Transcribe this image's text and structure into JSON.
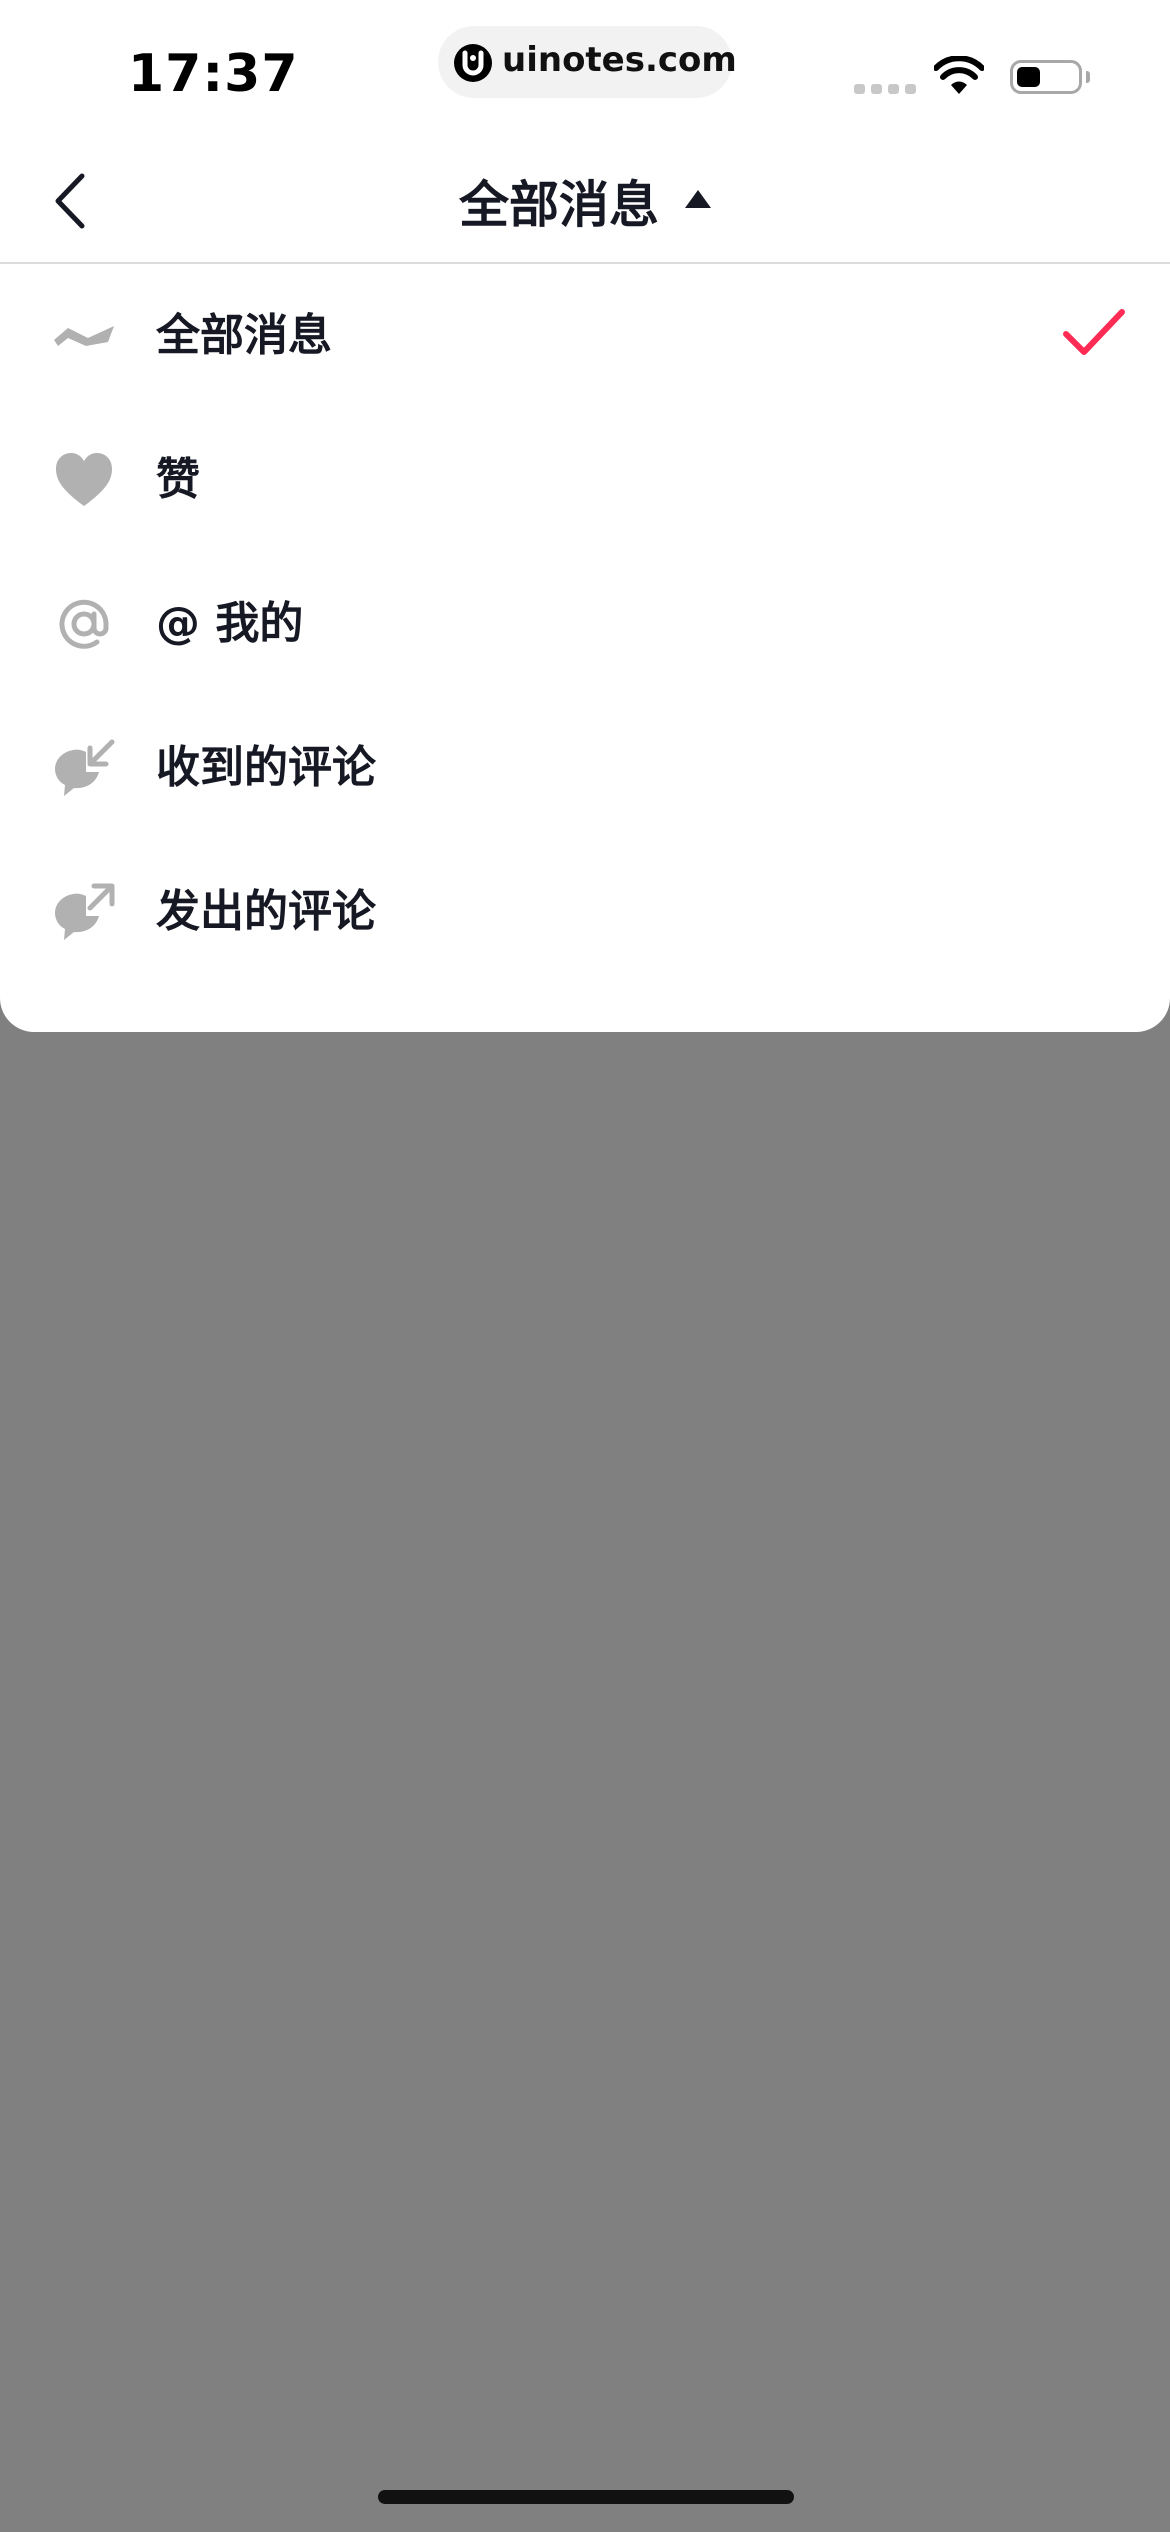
{
  "status_bar": {
    "time": "17:37",
    "url": "uinotes.com",
    "battery_level": 0.4
  },
  "nav": {
    "title": "全部消息"
  },
  "menu": {
    "items": [
      {
        "label": "全部消息",
        "icon": "wave-icon",
        "selected": true
      },
      {
        "label": "赞",
        "icon": "heart-icon",
        "selected": false
      },
      {
        "label": "@ 我的",
        "icon": "at-icon",
        "selected": false
      },
      {
        "label": "收到的评论",
        "icon": "comment-received-icon",
        "selected": false
      },
      {
        "label": "发出的评论",
        "icon": "comment-sent-icon",
        "selected": false
      }
    ]
  },
  "colors": {
    "accent": "#fe2c55",
    "icon_gray": "#b1b1b1",
    "text": "#161823",
    "overlay": "#808080"
  }
}
